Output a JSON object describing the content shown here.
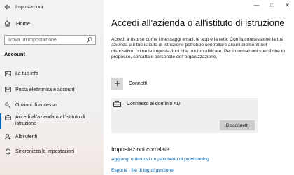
{
  "window": {
    "title": "Impostazioni"
  },
  "sidebar": {
    "home_label": "Home",
    "search_placeholder": "Trova un'impostazione",
    "section_label": "Account",
    "items": [
      {
        "label": "Le tue info",
        "icon": "person-card-icon"
      },
      {
        "label": "Posta elettronica e account",
        "icon": "mail-icon"
      },
      {
        "label": "Opzioni di accesso",
        "icon": "key-icon"
      },
      {
        "label": "Accedi all'azienda o all'istituto di istruzione",
        "icon": "briefcase-icon",
        "selected": true
      },
      {
        "label": "Altri utenti",
        "icon": "person-add-icon"
      },
      {
        "label": "Sincronizza le impostazioni",
        "icon": "sync-icon"
      }
    ]
  },
  "main": {
    "title": "Accedi all'azienda o all'istituto di istruzione",
    "description": "Accedi a risorse come i messaggi email, le app e la rete. Con la connessione la tua azienda o il tuo istituto di istruzione potrebbe controllare alcuni elementi nel dispositivo, come le impostazioni che puoi modificare. Per informazioni specifiche in proposito, contatta il personale dell'organizzazione.",
    "connect_label": "Connetti",
    "domain": {
      "label": "Connesso al dominio AD",
      "disconnect_label": "Disconnetti"
    },
    "related": {
      "title": "Impostazioni correlate",
      "links": [
        "Aggiungi o rimuovi un pacchetto di provisioning",
        "Esporta i file di log di gestione"
      ]
    }
  },
  "colors": {
    "accent": "#0a64b4",
    "link": "#0063b1",
    "sidebar_bg": "#f2f2f2"
  }
}
